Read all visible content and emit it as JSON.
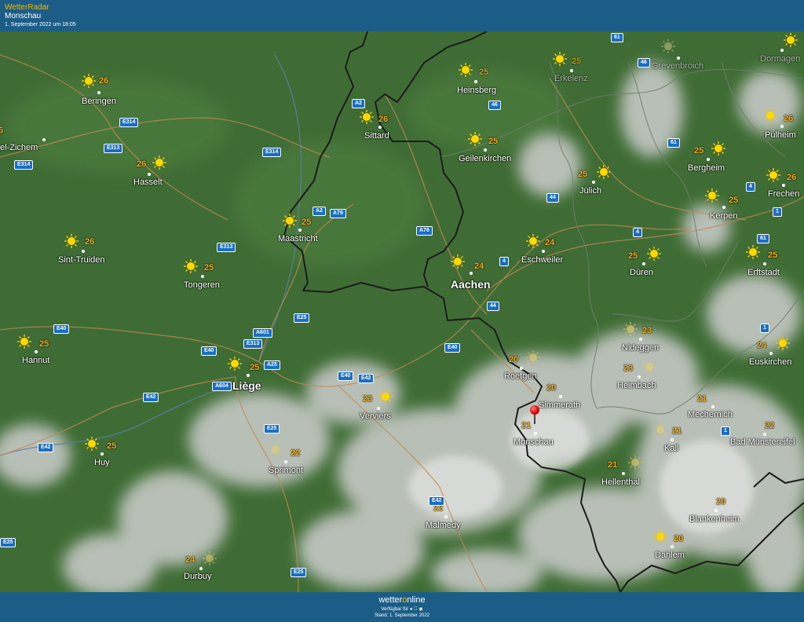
{
  "header": {
    "app_title": "WetterRadar",
    "location": "Monschau",
    "timestamp": "1. September 2022 um 18:05"
  },
  "footer": {
    "brand_pre": "wetter",
    "brand_o": "o",
    "brand_post": "nline",
    "availability": "Verfügbar für",
    "stand": "Stand: 1. September 2022"
  },
  "colors": {
    "header_bg": "#1b5d87",
    "accent": "#f5b800",
    "temp": "#f2b01e",
    "land": "#3e6b33",
    "road_sign": "#1a6fc4",
    "marker": "#d40000"
  },
  "cities": [
    {
      "name": "Beringen",
      "temp": "26"
    },
    {
      "name": "Hasselt",
      "temp": "26"
    },
    {
      "name": "Sint-Truiden",
      "temp": "26"
    },
    {
      "name": "Tongeren",
      "temp": "25"
    },
    {
      "name": "Hannut",
      "temp": "25"
    },
    {
      "name": "Huy",
      "temp": "25"
    },
    {
      "name": "Durbuy",
      "temp": "24"
    },
    {
      "name": "Maastricht",
      "temp": "25"
    },
    {
      "name": "Sittard",
      "temp": "26"
    },
    {
      "name": "Heinsberg",
      "temp": "25"
    },
    {
      "name": "Erkelenz",
      "temp": "25"
    },
    {
      "name": "Geilenkirchen",
      "temp": "25"
    },
    {
      "name": "Liège",
      "temp": "25"
    },
    {
      "name": "Verviers",
      "temp": "23"
    },
    {
      "name": "Sprimont",
      "temp": "22"
    },
    {
      "name": "Malmedy",
      "temp": "22"
    },
    {
      "name": "Aachen",
      "temp": "24"
    },
    {
      "name": "Eschweiler",
      "temp": "24"
    },
    {
      "name": "Jülich",
      "temp": "25"
    },
    {
      "name": "Düren",
      "temp": "25"
    },
    {
      "name": "Roetgen",
      "temp": "20"
    },
    {
      "name": "Simmerath",
      "temp": "20"
    },
    {
      "name": "Monschau",
      "temp": "21"
    },
    {
      "name": "Nideggen",
      "temp": "23"
    },
    {
      "name": "Heimbach",
      "temp": "23"
    },
    {
      "name": "Hellenthal",
      "temp": "21"
    },
    {
      "name": "Mechernich",
      "temp": "21"
    },
    {
      "name": "Kall",
      "temp": "21"
    },
    {
      "name": "Bad Münstereifel",
      "temp": "22"
    },
    {
      "name": "Blankenheim",
      "temp": "20"
    },
    {
      "name": "Dahlem",
      "temp": "20"
    },
    {
      "name": "Grevenbroich",
      "temp": ""
    },
    {
      "name": "Dormagen",
      "temp": ""
    },
    {
      "name": "Bergheim",
      "temp": "25"
    },
    {
      "name": "Pulheim",
      "temp": "26"
    },
    {
      "name": "Frechen",
      "temp": "26"
    },
    {
      "name": "Kerpen",
      "temp": "25"
    },
    {
      "name": "Erftstadt",
      "temp": "25"
    },
    {
      "name": "Euskirchen",
      "temp": "24"
    },
    {
      "name": "el-Zichem",
      "temp": "6"
    }
  ],
  "roads": [
    "E314",
    "E313",
    "E314",
    "E314",
    "A2",
    "A2",
    "A79",
    "E313",
    "A76",
    "E40",
    "E313",
    "A601",
    "E25",
    "E40",
    "A604",
    "A25",
    "E42",
    "E40",
    "E42",
    "E42",
    "E25",
    "E40",
    "E25",
    "E42",
    "E25",
    "4",
    "44",
    "44",
    "61",
    "46",
    "46",
    "61",
    "4",
    "4",
    "1",
    "61",
    "1",
    "1"
  ]
}
